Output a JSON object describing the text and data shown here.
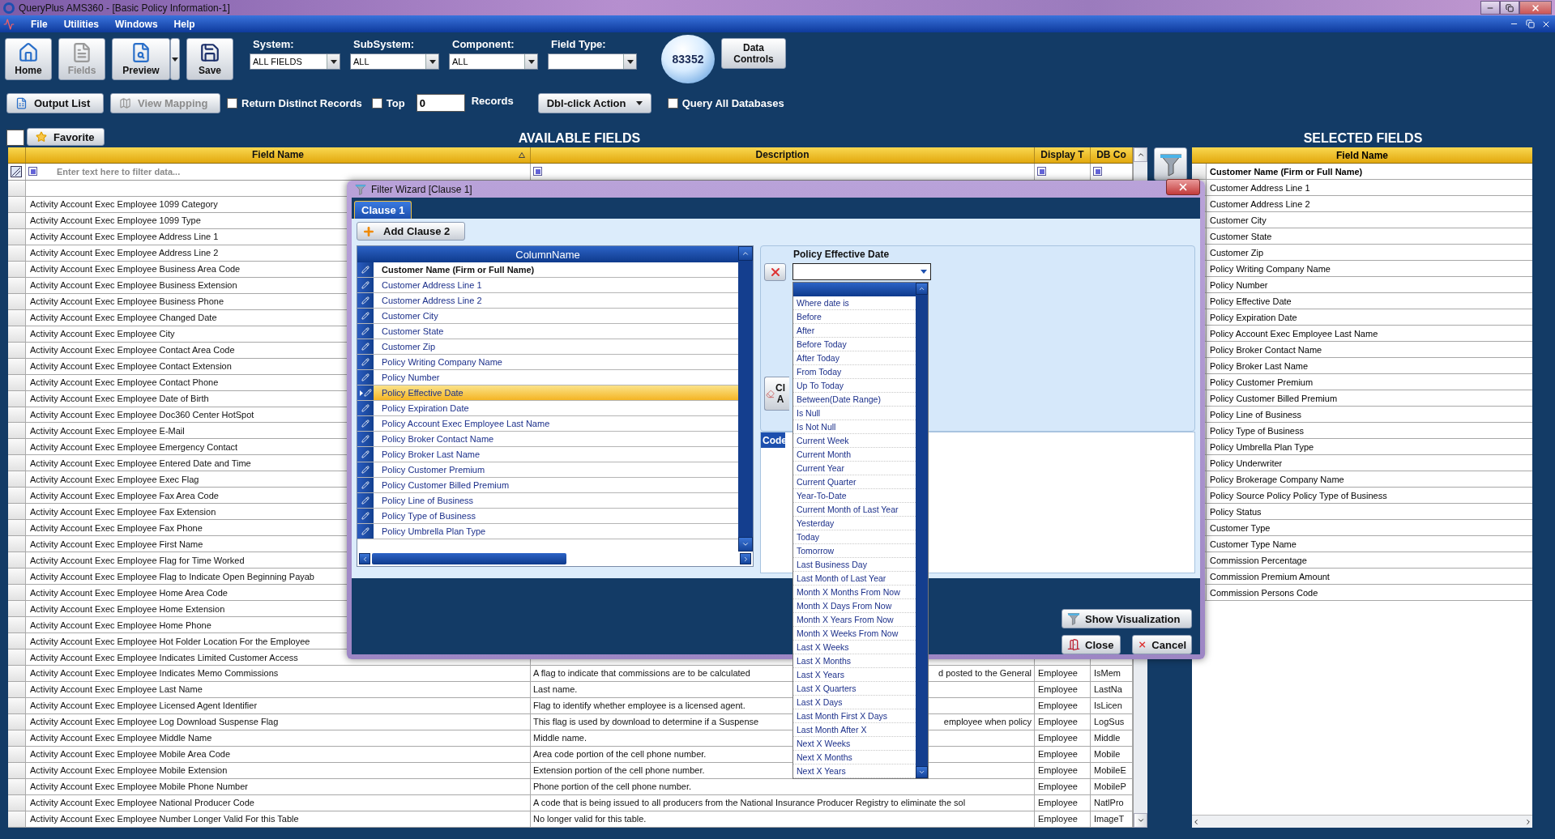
{
  "window": {
    "title": "QueryPlus AMS360 - [Basic Policy Information-1]"
  },
  "menu": [
    "File",
    "Utilities",
    "Windows",
    "Help"
  ],
  "toolbar": {
    "buttons": [
      {
        "label": "Home",
        "kind": "home",
        "disabled": false
      },
      {
        "label": "Fields",
        "kind": "fields",
        "disabled": true
      },
      {
        "label": "Preview",
        "kind": "preview",
        "disabled": false
      },
      {
        "label": "Save",
        "kind": "save",
        "disabled": false
      }
    ],
    "selectors": [
      {
        "label": "System:",
        "value": "ALL FIELDS"
      },
      {
        "label": "SubSystem:",
        "value": "ALL"
      },
      {
        "label": "Component:",
        "value": "ALL"
      },
      {
        "label": "Field Type:"
      }
    ],
    "count_badge": "83352",
    "data_controls": "Data Controls"
  },
  "options_bar": {
    "output_list": {
      "label": "Output List",
      "disabled": false
    },
    "view_mapping": {
      "label": "View Mapping",
      "disabled": true
    },
    "distinct": {
      "label": "Return Distinct Records",
      "checked": false
    },
    "top": {
      "label": "Top",
      "checked": false
    },
    "top_value": "0",
    "records_label": "Records",
    "dbl_click": "Dbl-click Action",
    "query_all": {
      "label": "Query All Databases",
      "checked": false
    }
  },
  "select_all": {
    "checked": false
  },
  "favorite": "Favorite",
  "available": {
    "title": "AVAILABLE FIELDS",
    "columns": [
      "Field Name",
      "Description",
      "Display T",
      "DB Co"
    ],
    "filter_placeholder": "Enter text here to filter data...",
    "rows": [
      {
        "name": "Activity Account Exec Employee 1099 Category"
      },
      {
        "name": "Activity Account Exec Employee 1099 Type"
      },
      {
        "name": "Activity Account Exec Employee Address Line 1"
      },
      {
        "name": "Activity Account Exec Employee Address Line 2"
      },
      {
        "name": "Activity Account Exec Employee Business Area Code"
      },
      {
        "name": "Activity Account Exec Employee Business Extension"
      },
      {
        "name": "Activity Account Exec Employee Business Phone"
      },
      {
        "name": "Activity Account Exec Employee Changed Date"
      },
      {
        "name": "Activity Account Exec Employee City"
      },
      {
        "name": "Activity Account Exec Employee Contact Area Code"
      },
      {
        "name": "Activity Account Exec Employee Contact Extension"
      },
      {
        "name": "Activity Account Exec Employee Contact Phone"
      },
      {
        "name": "Activity Account Exec Employee Date of Birth"
      },
      {
        "name": "Activity Account Exec Employee Doc360 Center HotSpot"
      },
      {
        "name": "Activity Account Exec Employee E-Mail"
      },
      {
        "name": "Activity Account Exec Employee Emergency Contact"
      },
      {
        "name": "Activity Account Exec Employee Entered Date and Time"
      },
      {
        "name": "Activity Account Exec Employee Exec Flag"
      },
      {
        "name": "Activity Account Exec Employee Fax Area Code"
      },
      {
        "name": "Activity Account Exec Employee Fax Extension"
      },
      {
        "name": "Activity Account Exec Employee Fax Phone"
      },
      {
        "name": "Activity Account Exec Employee First Name"
      },
      {
        "name": "Activity Account Exec Employee Flag for Time Worked"
      },
      {
        "name": "Activity Account Exec Employee Flag to Indicate Open Beginning Payab"
      },
      {
        "name": "Activity Account Exec Employee Home Area Code"
      },
      {
        "name": "Activity Account Exec Employee Home Extension"
      },
      {
        "name": "Activity Account Exec Employee Home Phone"
      },
      {
        "name": "Activity Account Exec Employee Hot Folder Location For the Employee"
      },
      {
        "name": "Activity Account Exec Employee Indicates Limited Customer Access"
      },
      {
        "name": "Activity Account Exec Employee Indicates Memo Commissions",
        "description": "A flag to indicate that commissions are to be calculated",
        "description_tail": "d posted to the General",
        "display": "Employee",
        "db": "IsMem"
      },
      {
        "name": "Activity Account Exec Employee Last Name",
        "description": "Last name.",
        "display": "Employee",
        "db": "LastNa"
      },
      {
        "name": "Activity Account Exec Employee Licensed Agent Identifier",
        "description": "Flag to identify whether employee is a licensed agent.",
        "display": "Employee",
        "db": "IsLicen"
      },
      {
        "name": "Activity Account Exec Employee Log Download Suspense Flag",
        "description": "This flag is used by download to determine if a Suspense",
        "description_tail": "employee when policy",
        "display": "Employee",
        "db": "LogSus"
      },
      {
        "name": "Activity Account Exec Employee Middle Name",
        "description": "Middle name.",
        "display": "Employee",
        "db": "Middle"
      },
      {
        "name": "Activity Account Exec Employee Mobile Area Code",
        "description": "Area code portion of the cell phone number.",
        "display": "Employee",
        "db": "Mobile"
      },
      {
        "name": "Activity Account Exec Employee Mobile Extension",
        "description": "Extension portion of the cell phone number.",
        "display": "Employee",
        "db": "MobileE"
      },
      {
        "name": "Activity Account Exec Employee Mobile Phone Number",
        "description": "Phone portion of the cell phone number.",
        "display": "Employee",
        "db": "MobileP"
      },
      {
        "name": "Activity Account Exec Employee National Producer Code",
        "description": "A code that is being issued to all producers from the National Insurance Producer Registry to eliminate the sol",
        "display": "Employee",
        "db": "NatlPro"
      },
      {
        "name": "Activity Account Exec Employee Number Longer Valid For this Table",
        "description": "No longer valid for this table.",
        "display": "Employee",
        "db": "ImageT"
      }
    ]
  },
  "selected_fields": {
    "title": "SELECTED FIELDS",
    "column": "Field Name",
    "rows": [
      {
        "name": "Customer Name (Firm or Full Name)",
        "current": true
      },
      {
        "name": "Customer Address Line 1",
        "current": false
      },
      {
        "name": "Customer Address Line 2",
        "current": false
      },
      {
        "name": "Customer City",
        "current": false
      },
      {
        "name": "Customer State",
        "current": false
      },
      {
        "name": "Customer Zip",
        "current": false
      },
      {
        "name": "Policy Writing Company Name",
        "current": false
      },
      {
        "name": "Policy Number",
        "current": false
      },
      {
        "name": "Policy Effective Date",
        "current": false
      },
      {
        "name": "Policy Expiration Date",
        "current": false
      },
      {
        "name": "Policy Account Exec Employee Last Name",
        "current": false
      },
      {
        "name": "Policy Broker Contact Name",
        "current": false
      },
      {
        "name": "Policy Broker Last Name",
        "current": false
      },
      {
        "name": "Policy Customer Premium",
        "current": false
      },
      {
        "name": "Policy Customer Billed Premium",
        "current": false
      },
      {
        "name": "Policy Line of Business",
        "current": false
      },
      {
        "name": "Policy Type of Business",
        "current": false
      },
      {
        "name": "Policy Umbrella Plan Type",
        "current": false
      },
      {
        "name": "Policy Underwriter",
        "current": false
      },
      {
        "name": "Policy Brokerage Company Name",
        "current": false
      },
      {
        "name": "Policy Source Policy Policy Type of Business",
        "current": false
      },
      {
        "name": "Policy Status",
        "current": false
      },
      {
        "name": "Customer Type",
        "current": false
      },
      {
        "name": "Customer Type Name",
        "current": false
      },
      {
        "name": "Commission Percentage",
        "current": false
      },
      {
        "name": "Commission Premium Amount",
        "current": false
      },
      {
        "name": "Commission Persons Code",
        "current": false
      }
    ]
  },
  "dialog": {
    "title": "Filter Wizard [Clause 1]",
    "tabs": [
      {
        "label": "Clause 1",
        "selected": true
      }
    ],
    "add_clause": "Add Clause 2",
    "grid": {
      "column": "ColumnName",
      "rows": [
        {
          "name": "Customer Name (Firm or Full Name)",
          "current": true,
          "selected": false
        },
        {
          "name": "Customer Address Line 1",
          "current": false,
          "selected": false
        },
        {
          "name": "Customer Address Line 2",
          "current": false,
          "selected": false
        },
        {
          "name": "Customer City",
          "current": false,
          "selected": false
        },
        {
          "name": "Customer State",
          "current": false,
          "selected": false
        },
        {
          "name": "Customer Zip",
          "current": false,
          "selected": false
        },
        {
          "name": "Policy Writing Company Name",
          "current": false,
          "selected": false
        },
        {
          "name": "Policy Number",
          "current": false,
          "selected": false
        },
        {
          "name": "Policy Effective Date",
          "current": false,
          "selected": true
        },
        {
          "name": "Policy Expiration Date",
          "current": false,
          "selected": false
        },
        {
          "name": "Policy Account Exec Employee Last Name",
          "current": false,
          "selected": false
        },
        {
          "name": "Policy Broker Contact Name",
          "current": false,
          "selected": false
        },
        {
          "name": "Policy Broker Last Name",
          "current": false,
          "selected": false
        },
        {
          "name": "Policy Customer Premium",
          "current": false,
          "selected": false
        },
        {
          "name": "Policy Customer Billed Premium",
          "current": false,
          "selected": false
        },
        {
          "name": "Policy Line of Business",
          "current": false,
          "selected": false
        },
        {
          "name": "Policy Type of Business",
          "current": false,
          "selected": false
        },
        {
          "name": "Policy Umbrella Plan Type",
          "current": false,
          "selected": false
        }
      ]
    },
    "criteria": {
      "field": "Policy Effective Date",
      "clear_label": [
        "Cl",
        "A"
      ],
      "options": [
        {
          "label": "Where date is",
          "selected": false
        },
        {
          "label": "Before",
          "selected": false
        },
        {
          "label": "After",
          "selected": false
        },
        {
          "label": "Before Today",
          "selected": false
        },
        {
          "label": "After Today",
          "selected": false
        },
        {
          "label": "From Today",
          "selected": false
        },
        {
          "label": "Up To Today",
          "selected": false
        },
        {
          "label": "Between(Date Range)",
          "selected": false
        },
        {
          "label": "Is Null",
          "selected": false
        },
        {
          "label": "Is Not Null",
          "selected": false
        },
        {
          "label": "Current Week",
          "selected": false
        },
        {
          "label": "Current Month",
          "selected": false
        },
        {
          "label": "Current Year",
          "selected": false
        },
        {
          "label": "Current Quarter",
          "selected": false
        },
        {
          "label": "Year-To-Date",
          "selected": false
        },
        {
          "label": "Current Month of Last Year",
          "selected": false
        },
        {
          "label": "Yesterday",
          "selected": false
        },
        {
          "label": "Today",
          "selected": false
        },
        {
          "label": "Tomorrow",
          "selected": false
        },
        {
          "label": "Last Business Day",
          "selected": false
        },
        {
          "label": "Last Month of Last Year",
          "selected": false
        },
        {
          "label": "Month X Months From Now",
          "selected": false
        },
        {
          "label": "Month X Days From Now",
          "selected": false
        },
        {
          "label": "Month X Years From Now",
          "selected": false
        },
        {
          "label": "Month X Weeks From Now",
          "selected": false
        },
        {
          "label": "Last X Weeks",
          "selected": false
        },
        {
          "label": "Last X Months",
          "selected": false
        },
        {
          "label": "Last X Years",
          "selected": false
        },
        {
          "label": "Last X Quarters",
          "selected": false
        },
        {
          "label": "Last X Days",
          "selected": false
        },
        {
          "label": "Last Month First X Days",
          "selected": false
        },
        {
          "label": "Last Month After X",
          "selected": false
        },
        {
          "label": "Next X Weeks",
          "selected": false
        },
        {
          "label": "Next X Months",
          "selected": false
        },
        {
          "label": "Next X Years",
          "selected": false
        }
      ]
    },
    "code_tab": "Code",
    "buttons": [
      {
        "label": "Show Visualization",
        "kind": "visualize"
      },
      {
        "label": "Close",
        "kind": "close"
      },
      {
        "label": "Cancel",
        "kind": "cancel"
      }
    ]
  }
}
